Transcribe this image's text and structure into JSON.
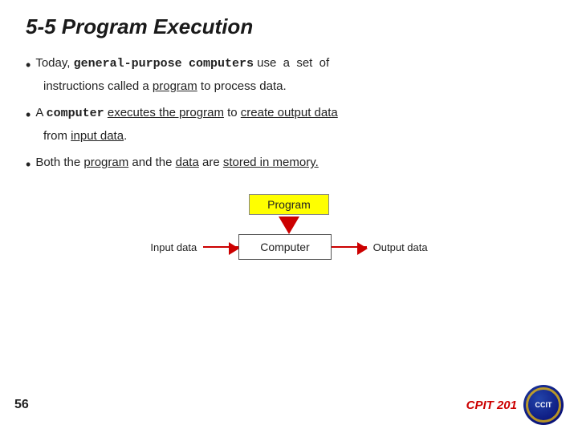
{
  "slide": {
    "title": "5-5  Program Execution",
    "bullets": [
      {
        "id": "bullet1",
        "prefix": "• ",
        "parts": [
          {
            "text": "Today, ",
            "style": "normal"
          },
          {
            "text": "general-purpose",
            "style": "mono"
          },
          {
            "text": "  ",
            "style": "normal"
          },
          {
            "text": "computers",
            "style": "mono"
          },
          {
            "text": " use  a  set  of",
            "style": "normal"
          }
        ],
        "continuation": "instructions called a program to process data."
      },
      {
        "id": "bullet2",
        "prefix": "• ",
        "text1": "A ",
        "mono1": "computer",
        "text2": " ",
        "underline1": "executes the program",
        "text3": " to ",
        "underline2": "create output data",
        "continuation": "from ",
        "underline3": "input data",
        "text4": "."
      },
      {
        "id": "bullet3",
        "prefix": "• ",
        "text1": "Both the ",
        "underline1": "program",
        "text2": " and the ",
        "underline2": "data",
        "text3": " are ",
        "underline3": "stored in memory."
      }
    ],
    "diagram": {
      "program_label": "Program",
      "input_label": "Input data",
      "computer_label": "Computer",
      "output_label": "Output data"
    },
    "footer": {
      "page_number": "56",
      "course_label": "CPIT 201"
    }
  }
}
